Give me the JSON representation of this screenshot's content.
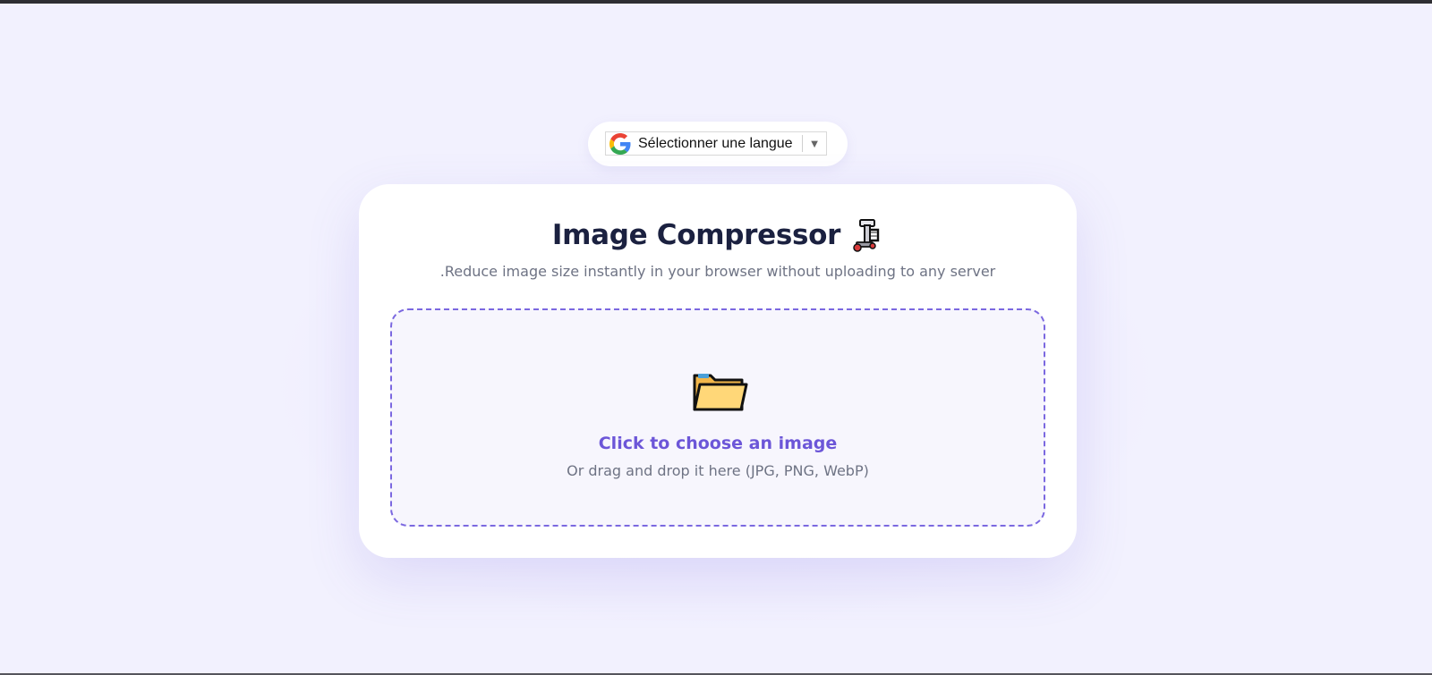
{
  "language_selector": {
    "label": "Sélectionner une langue",
    "arrow": "▼",
    "logo_icon": "google-g-icon"
  },
  "compressor": {
    "title": "Image Compressor",
    "title_icon": "clamp-icon",
    "subtitle": ".Reduce image size instantly in your browser without uploading to any server"
  },
  "dropzone": {
    "icon": "folder-icon",
    "primary_text": "Click to choose an image",
    "secondary_text": "Or drag and drop it here (JPG, PNG, WebP)"
  },
  "colors": {
    "accent": "#6c56d8",
    "dropzone_border": "#7b68e0",
    "title": "#1b2140",
    "muted_text": "#6e7384",
    "page_background": "#f2f1fe",
    "folder": "#ffd778"
  }
}
